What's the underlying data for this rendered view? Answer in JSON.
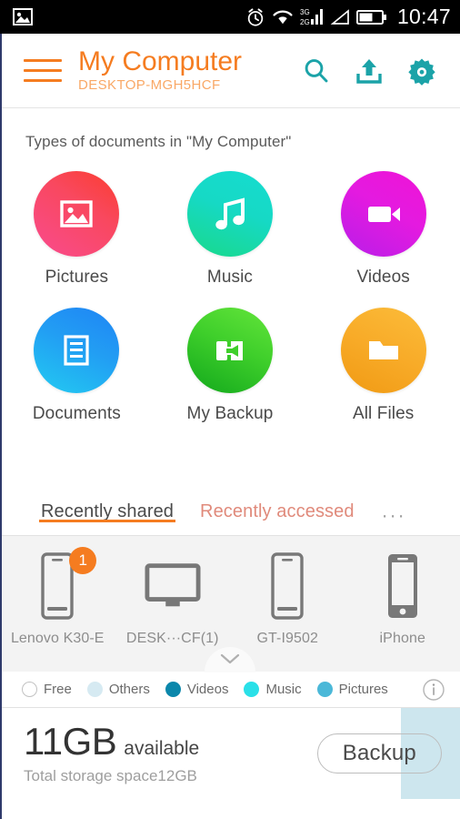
{
  "statusbar": {
    "time": "10:47",
    "icons": [
      "image-icon",
      "alarm-icon",
      "wifi-icon",
      "signal-3g-2g-icon",
      "signal-triangle-icon",
      "battery-icon"
    ],
    "network_labels": {
      "top": "3G",
      "bottom": "2G"
    }
  },
  "header": {
    "menu_icon": "hamburger-menu-icon",
    "title": "My Computer",
    "subtitle": "DESKTOP-MGH5HCF",
    "actions": [
      {
        "name": "search-icon",
        "label": "Search"
      },
      {
        "name": "upload-icon",
        "label": "Upload"
      },
      {
        "name": "settings-gear-icon",
        "label": "Settings"
      }
    ],
    "accent_color": "#f57c20",
    "action_color": "#1ba3a8"
  },
  "content": {
    "section_title": "Types of documents in \"My Computer\"",
    "tiles": [
      {
        "label": "Pictures",
        "icon": "picture-icon",
        "color_from": "#f9485f",
        "color_to": "#fa3e55"
      },
      {
        "label": "Music",
        "icon": "music-note-icon",
        "color_from": "#16d9c5",
        "color_to": "#16d98e"
      },
      {
        "label": "Videos",
        "icon": "video-camera-icon",
        "color_from": "#e41ae0",
        "color_to": "#c11ae4"
      },
      {
        "label": "Documents",
        "icon": "document-icon",
        "color_from": "#1f8ff5",
        "color_to": "#1fc9f5"
      },
      {
        "label": "My Backup",
        "icon": "backup-arrow-icon",
        "color_from": "#5fe23a",
        "color_to": "#1fae1f"
      },
      {
        "label": "All Files",
        "icon": "folder-icon",
        "color_from": "#f9b233",
        "color_to": "#f2a01d"
      }
    ]
  },
  "tabs": {
    "items": [
      {
        "label": "Recently shared",
        "active": true
      },
      {
        "label": "Recently accessed",
        "active": false
      }
    ],
    "more_label": "···",
    "active_underline_color": "#f57c20"
  },
  "devices": {
    "items": [
      {
        "label": "Lenovo K30-E",
        "icon": "phone-icon",
        "badge": "1"
      },
      {
        "label": "DESK···CF(1)",
        "icon": "monitor-icon",
        "badge": ""
      },
      {
        "label": "GT-I9502",
        "icon": "phone-icon",
        "badge": ""
      },
      {
        "label": "iPhone",
        "icon": "iphone-icon",
        "badge": ""
      }
    ],
    "pull_handle_icon": "chevron-down-icon"
  },
  "legend": {
    "items": [
      {
        "label": "Free",
        "color": "#ffffff"
      },
      {
        "label": "Others",
        "color": "#d6eaf2"
      },
      {
        "label": "Videos",
        "color": "#0b87ab"
      },
      {
        "label": "Music",
        "color": "#2ae0e8"
      },
      {
        "label": "Pictures",
        "color": "#4bb8d8"
      }
    ],
    "info_icon": "info-circle-icon"
  },
  "storage": {
    "available_value": "11GB",
    "available_label": "available",
    "total_label": "Total storage space12GB",
    "backup_button": "Backup",
    "used_fill_color": "#cde6ee"
  }
}
